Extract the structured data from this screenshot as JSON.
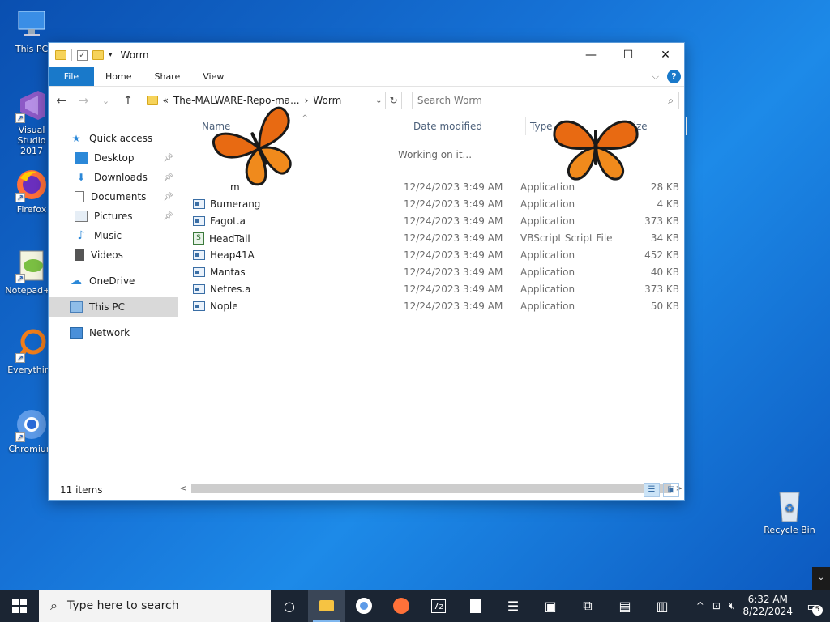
{
  "desktop": {
    "icons": [
      {
        "label": "This PC"
      },
      {
        "label": "Visual Studio 2017"
      },
      {
        "label": "Firefox"
      },
      {
        "label": "Notepad++"
      },
      {
        "label": "Everything"
      },
      {
        "label": "Chromium"
      },
      {
        "label": "Recycle Bin"
      }
    ]
  },
  "window": {
    "title": "Worm",
    "controls": {
      "minimize": "—",
      "maximize": "☐",
      "close": "✕"
    },
    "ribbon_tabs": [
      "File",
      "Home",
      "Share",
      "View"
    ],
    "address": {
      "part1": "The-MALWARE-Repo-ma...",
      "separator": "›",
      "part2": "Worm",
      "prefix": "«"
    },
    "search_placeholder": "Search Worm",
    "sidebar": [
      {
        "label": "Quick access",
        "icon": "star-icon"
      },
      {
        "label": "Desktop",
        "icon": "desktop-icon",
        "pinned": true
      },
      {
        "label": "Downloads",
        "icon": "download-icon",
        "pinned": true
      },
      {
        "label": "Documents",
        "icon": "documents-icon",
        "pinned": true
      },
      {
        "label": "Pictures",
        "icon": "pictures-icon",
        "pinned": true
      },
      {
        "label": "Music",
        "icon": "music-icon"
      },
      {
        "label": "Videos",
        "icon": "videos-icon"
      },
      {
        "label": "OneDrive",
        "icon": "cloud-icon"
      },
      {
        "label": "This PC",
        "icon": "computer-icon"
      },
      {
        "label": "Network",
        "icon": "network-icon"
      }
    ],
    "columns": {
      "name": "Name",
      "date": "Date modified",
      "type": "Type",
      "size": "Size"
    },
    "working_text": "Working on it...",
    "files": [
      {
        "name": "m",
        "date": "12/24/2023 3:49 AM",
        "type": "Application",
        "size": "28 KB",
        "icon": "none"
      },
      {
        "name": "Bumerang",
        "date": "12/24/2023 3:49 AM",
        "type": "Application",
        "size": "4 KB",
        "icon": "app"
      },
      {
        "name": "Fagot.a",
        "date": "12/24/2023 3:49 AM",
        "type": "Application",
        "size": "373 KB",
        "icon": "app"
      },
      {
        "name": "HeadTail",
        "date": "12/24/2023 3:49 AM",
        "type": "VBScript Script File",
        "size": "34 KB",
        "icon": "vbs"
      },
      {
        "name": "Heap41A",
        "date": "12/24/2023 3:49 AM",
        "type": "Application",
        "size": "452 KB",
        "icon": "app"
      },
      {
        "name": "Mantas",
        "date": "12/24/2023 3:49 AM",
        "type": "Application",
        "size": "40 KB",
        "icon": "app"
      },
      {
        "name": "Netres.a",
        "date": "12/24/2023 3:49 AM",
        "type": "Application",
        "size": "373 KB",
        "icon": "app"
      },
      {
        "name": "Nople",
        "date": "12/24/2023 3:49 AM",
        "type": "Application",
        "size": "50 KB",
        "icon": "app"
      }
    ],
    "status": "11 items"
  },
  "taskbar": {
    "search_placeholder": "Type here to search",
    "apps": [
      "task-view-icon",
      "file-explorer-icon",
      "chromium-icon",
      "firefox-icon",
      "7zip-icon",
      "document-icon",
      "list-icon",
      "window-icon",
      "installer-icon",
      "package-icon",
      "archive-icon"
    ],
    "time": "6:32 AM",
    "date": "8/22/2024",
    "notification_count": "5"
  },
  "colors": {
    "accent": "#1979ca",
    "taskbar": "#1b2533",
    "selection": "#d9d9d9"
  }
}
